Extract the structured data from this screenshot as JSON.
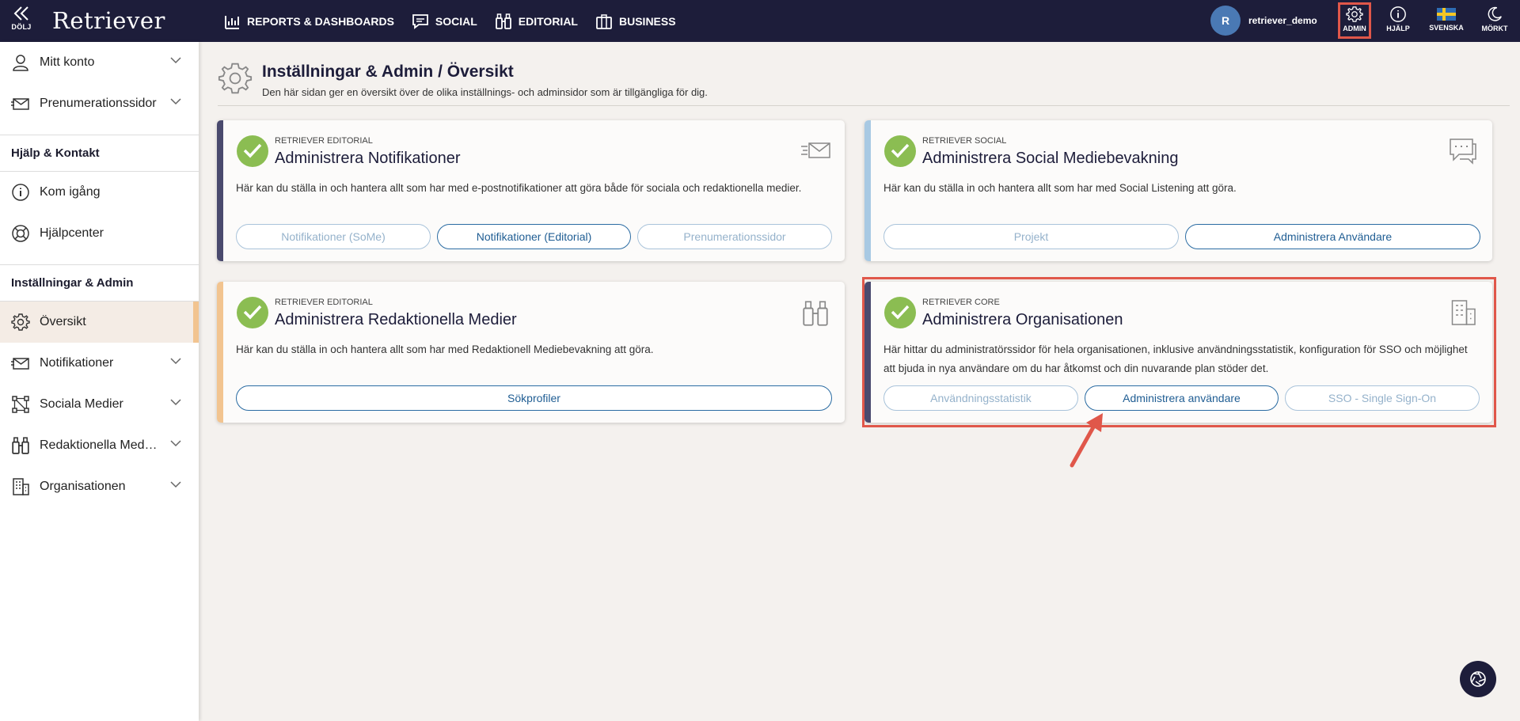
{
  "topbar": {
    "hide_label": "DÖLJ",
    "logo": "Retriever",
    "nav": [
      {
        "label": "REPORTS & DASHBOARDS",
        "icon": "chart-icon"
      },
      {
        "label": "SOCIAL",
        "icon": "chat-icon"
      },
      {
        "label": "EDITORIAL",
        "icon": "binoculars-icon"
      },
      {
        "label": "BUSINESS",
        "icon": "briefcase-icon"
      }
    ],
    "avatar_initial": "R",
    "username": "retriever_demo",
    "tools": {
      "admin": "ADMIN",
      "help": "HJÄLP",
      "language": "SVENSKA",
      "dark": "MÖRKT"
    }
  },
  "sidebar": {
    "account": [
      {
        "label": "Mitt konto",
        "icon": "user-icon"
      },
      {
        "label": "Prenumerationssidor",
        "icon": "envelope-icon"
      }
    ],
    "help_header": "Hjälp & Kontakt",
    "help": [
      {
        "label": "Kom igång",
        "icon": "info-icon"
      },
      {
        "label": "Hjälpcenter",
        "icon": "lifebuoy-icon"
      }
    ],
    "admin_header": "Inställningar & Admin",
    "admin": [
      {
        "label": "Översikt",
        "icon": "gear-icon"
      },
      {
        "label": "Notifikationer",
        "icon": "envelope-icon"
      },
      {
        "label": "Sociala Medier",
        "icon": "network-icon"
      },
      {
        "label": "Redaktionella Medier",
        "icon": "binoculars-icon"
      },
      {
        "label": "Organisationen",
        "icon": "building-icon"
      }
    ]
  },
  "page": {
    "title": "Inställningar & Admin / Översikt",
    "subtitle": "Den här sidan ger en översikt över de olika inställnings- och adminsidor som är tillgängliga för dig."
  },
  "cards": {
    "notif": {
      "eyebrow": "RETRIEVER EDITORIAL",
      "title": "Administrera Notifikationer",
      "desc": "Här kan du ställa in och hantera allt som har med e-postnotifikationer att göra både för sociala och redaktionella medier.",
      "buttons": [
        "Notifikationer (SoMe)",
        "Notifikationer (Editorial)",
        "Prenumerationssidor"
      ]
    },
    "social": {
      "eyebrow": "RETRIEVER SOCIAL",
      "title": "Administrera Social Mediebevakning",
      "desc": "Här kan du ställa in och hantera allt som har med Social Listening att göra.",
      "buttons": [
        "Projekt",
        "Administrera Användare"
      ]
    },
    "editorial": {
      "eyebrow": "RETRIEVER EDITORIAL",
      "title": "Administrera Redaktionella Medier",
      "desc": "Här kan du ställa in och hantera allt som har med Redaktionell Mediebevakning att göra.",
      "buttons": [
        "Sökprofiler"
      ]
    },
    "org": {
      "eyebrow": "RETRIEVER CORE",
      "title": "Administrera Organisationen",
      "desc": "Här hittar du administratörssidor för hela organisationen, inklusive användningsstatistik, konfiguration för SSO och möjlighet att bjuda in nya användare om du har åtkomst och din nuvarande plan stöder det.",
      "buttons": [
        "Användningsstatistik",
        "Administrera användare",
        "SSO - Single Sign-On"
      ]
    }
  },
  "colors": {
    "navy": "#1d1d3a",
    "accent_blue": "#2b6ca3",
    "check_green": "#8bbd52",
    "highlight_red": "#e0574a",
    "bar_notif": "#4a4a6e",
    "bar_social": "#a8c9e3",
    "bar_editorial": "#f2c490",
    "bar_org": "#4a4a6e"
  }
}
